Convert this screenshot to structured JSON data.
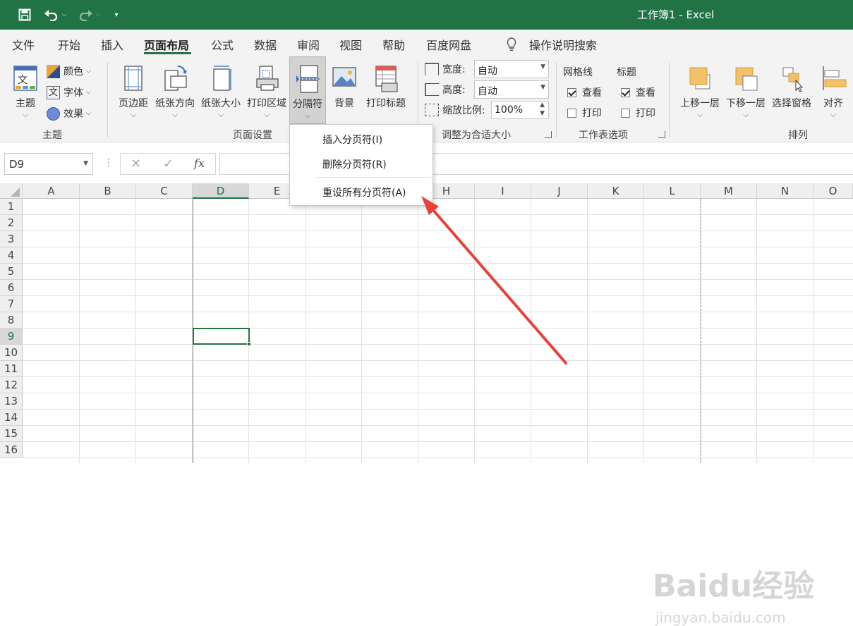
{
  "titlebar": {
    "title": "工作簿1 - Excel",
    "colors": {
      "bg": "#217346"
    }
  },
  "tabs": [
    "文件",
    "开始",
    "插入",
    "页面布局",
    "公式",
    "数据",
    "审阅",
    "视图",
    "帮助",
    "百度网盘"
  ],
  "active_tab": "页面布局",
  "search_label": "操作说明搜索",
  "ribbon": {
    "theme": {
      "btn": "主题",
      "colors": "颜色",
      "fonts": "字体",
      "effects": "效果",
      "group": "主题"
    },
    "page_setup": {
      "margins": "页边距",
      "orientation": "纸张方向",
      "size": "纸张大小",
      "print_area": "打印区域",
      "breaks": "分隔符",
      "background": "背景",
      "print_titles": "打印标题",
      "group": "页面设置"
    },
    "scale": {
      "width_label": "宽度:",
      "width_value": "自动",
      "height_label": "高度:",
      "height_value": "自动",
      "scale_label": "缩放比例:",
      "scale_value": "100%",
      "group": "调整为合适大小"
    },
    "sheet_options": {
      "gridlines": "网格线",
      "headings": "标题",
      "view": "查看",
      "print": "打印",
      "group": "工作表选项"
    },
    "arrange": {
      "bring_forward": "上移一层",
      "send_backward": "下移一层",
      "selection_pane": "选择窗格",
      "align": "对齐",
      "group": "排列"
    }
  },
  "formula_bar": {
    "name_box": "D9",
    "fx": "fx"
  },
  "columns": [
    "A",
    "B",
    "C",
    "D",
    "E",
    "F",
    "G",
    "H",
    "I",
    "J",
    "K",
    "L",
    "M",
    "N",
    "O"
  ],
  "rows": [
    "1",
    "2",
    "3",
    "4",
    "5",
    "6",
    "7",
    "8",
    "9",
    "10",
    "11",
    "12",
    "13",
    "14",
    "15",
    "16"
  ],
  "selected_cell": {
    "col": "D",
    "row": "9"
  },
  "dropdown": {
    "insert": "插入分页符(I)",
    "remove": "删除分页符(R)",
    "reset": "重设所有分页符(A)"
  },
  "watermark": {
    "main": "Baidu经验",
    "sub": "jingyan.baidu.com"
  },
  "annotation_color": "#e8403a"
}
